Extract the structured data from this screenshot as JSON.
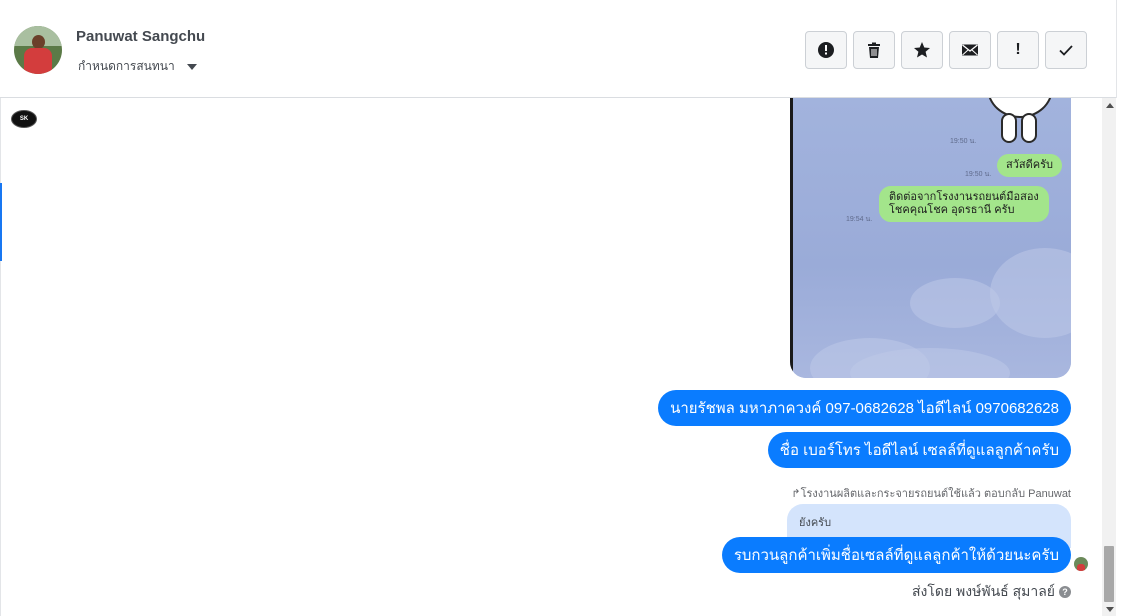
{
  "header": {
    "contact_name": "Panuwat Sangchu",
    "conversation_settings_label": "กำหนดการสนทนา"
  },
  "toolbar": {
    "buttons": [
      {
        "icon": "alert-circle-icon"
      },
      {
        "icon": "trash-icon"
      },
      {
        "icon": "star-icon"
      },
      {
        "icon": "envelope-icon"
      },
      {
        "icon": "exclamation-icon",
        "label": "!"
      },
      {
        "icon": "checkmark-icon"
      }
    ]
  },
  "image_attachment": {
    "line_messages": [
      {
        "time": "19:50 น."
      },
      {
        "time": "19:50 น.",
        "text": "สวัสดีครับ"
      },
      {
        "time": "19:54 น.",
        "text_line1": "ติดต่อจากโรงงานรถยนต์มือสอง",
        "text_line2": "โชคคุณโชค อุดรธานี ครับ"
      }
    ]
  },
  "messages": [
    {
      "text": "นายรัชพล มหาภาควงค์  097-0682628 ไอดีไลน์ 0970682628"
    },
    {
      "text": "ชื่อ เบอร์โทร ไอดีไลน์ เซลล์ที่ดูแลลูกค้าครับ"
    }
  ],
  "reply": {
    "meta": "โรงงานผลิตและกระจายรถยนต์ใช้แล้ว ตอบกลับ Panuwat",
    "quoted_text": "ยังครับ",
    "message": "รบกวนลูกค้าเพิ่มชื่อเซลล์ที่ดูแลลูกค้าให้ด้วยนะครับ"
  },
  "sent_by": "ส่งโดย พงษ์พันธ์ สุมาลย์",
  "colors": {
    "bubble_blue": "#0a7cff",
    "line_green": "#a3e58b",
    "accent": "#1877f2"
  }
}
